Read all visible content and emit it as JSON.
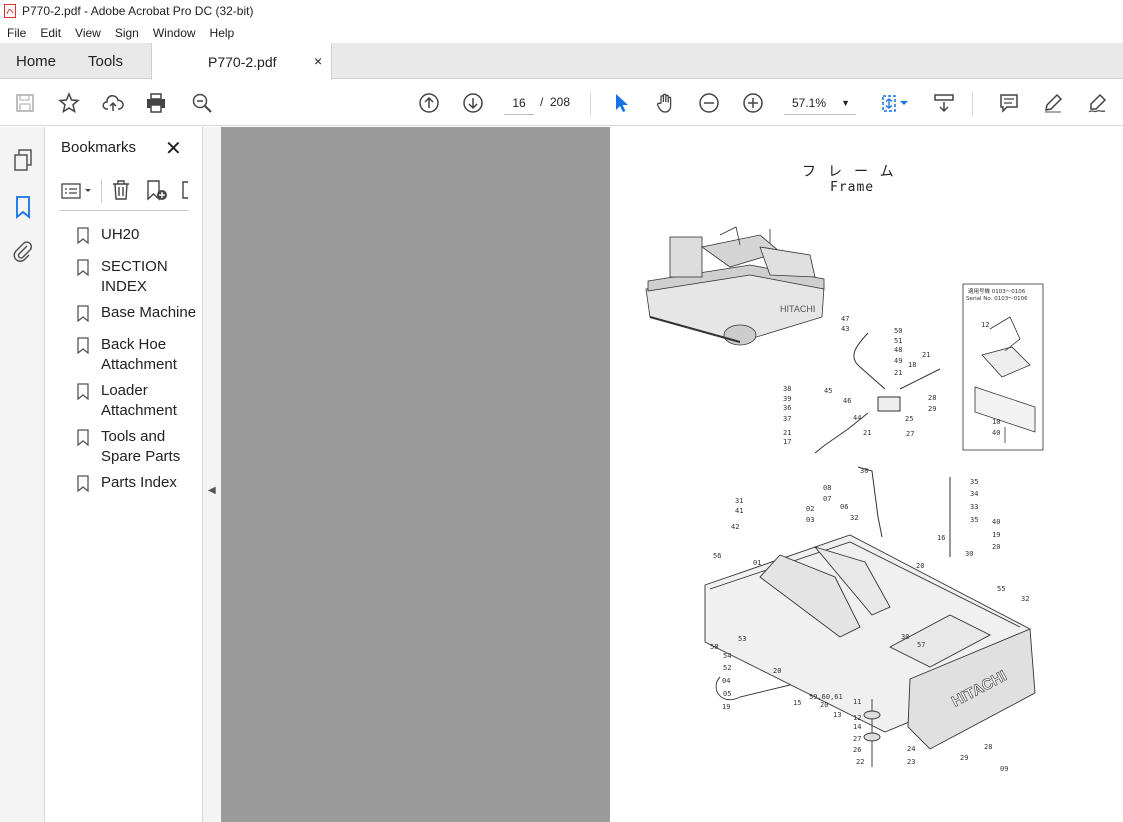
{
  "window": {
    "title": "P770-2.pdf - Adobe Acrobat Pro DC (32-bit)"
  },
  "menu": [
    "File",
    "Edit",
    "View",
    "Sign",
    "Window",
    "Help"
  ],
  "tabs": {
    "home": "Home",
    "tools": "Tools",
    "document": "P770-2.pdf",
    "close": "×"
  },
  "toolbar": {
    "page_current": "16",
    "page_separator": "/",
    "page_total": "208",
    "zoom": "57.1%"
  },
  "bookmarks": {
    "title": "Bookmarks",
    "close": "✕",
    "items": [
      "UH20",
      "SECTION INDEX",
      "Base Machine",
      "Back Hoe Attachment",
      "Loader Attachment",
      "Tools and Spare Parts",
      "Parts Index"
    ]
  },
  "document": {
    "heading_jp": "フレーム",
    "heading_en": "Frame",
    "inset_title": "適用号機 0103～0106",
    "inset_serial": "Serial No. 0103～0106",
    "callouts": [
      "47",
      "43",
      "50",
      "51",
      "48",
      "49",
      "21",
      "18",
      "21",
      "38",
      "39",
      "36",
      "37",
      "45",
      "46",
      "44",
      "28",
      "29",
      "25",
      "27",
      "21",
      "17",
      "21",
      "30",
      "35",
      "34",
      "33",
      "35",
      "08",
      "07",
      "02",
      "03",
      "06",
      "32",
      "31",
      "41",
      "42",
      "40",
      "19",
      "20",
      "16",
      "30",
      "20",
      "56",
      "01",
      "55",
      "32",
      "30",
      "57",
      "58",
      "53",
      "54",
      "52",
      "04",
      "05",
      "19",
      "20",
      "15",
      "59,60,61",
      "20",
      "13",
      "11",
      "12",
      "14",
      "27",
      "26",
      "22",
      "24",
      "23",
      "29",
      "28",
      "09",
      "12",
      "10",
      "40",
      "42",
      "41"
    ],
    "brand": "HITACHI"
  }
}
